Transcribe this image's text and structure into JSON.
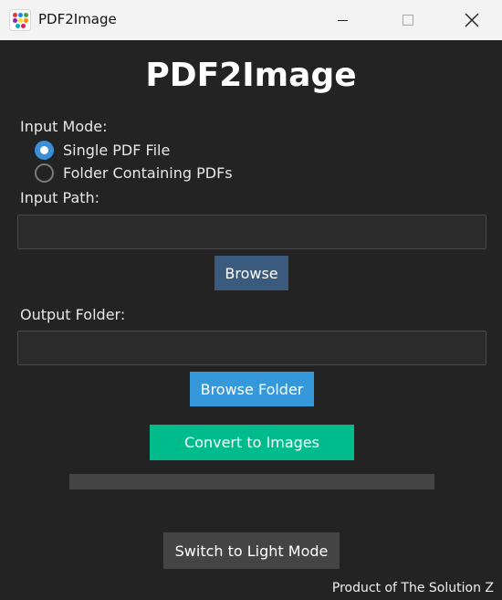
{
  "window": {
    "title": "PDF2Image",
    "controls": [
      "minimize-icon",
      "maximize-icon",
      "close-icon"
    ]
  },
  "app": {
    "heading": "PDF2Image"
  },
  "input_mode": {
    "label": "Input Mode:",
    "options": [
      {
        "label": "Single PDF File",
        "selected": true
      },
      {
        "label": "Folder Containing PDFs",
        "selected": false
      }
    ]
  },
  "input_path": {
    "label": "Input Path:",
    "value": "",
    "placeholder": "",
    "browse_label": "Browse"
  },
  "output_folder": {
    "label": "Output Folder:",
    "value": "",
    "placeholder": "",
    "browse_label": "Browse Folder"
  },
  "convert": {
    "label": "Convert to Images",
    "progress": 0
  },
  "theme_toggle_label": "Switch to Light Mode",
  "footer": "Product of The Solution Z",
  "colors": {
    "background": "#232323",
    "primary": "#3498db",
    "success": "#00bc8c",
    "browse_button": "#3a5a7e",
    "neutral_button": "#444444"
  }
}
